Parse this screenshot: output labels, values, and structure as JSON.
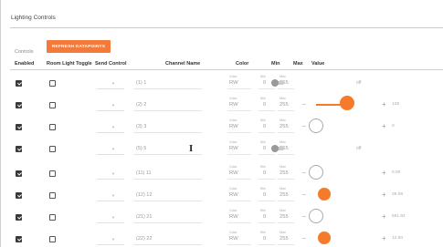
{
  "panel": {
    "title": "Lighting Controls"
  },
  "controls": {
    "label": "Controls",
    "refresh_label": "REFRESH DATAPOINTS"
  },
  "headers": {
    "enabled": "Enabled",
    "room_light_toggle": "Room Light Toggle",
    "send_control": "Send Control",
    "channel_name": "Channel Name",
    "color": "Color",
    "min": "Min",
    "max": "Max",
    "value": "Value"
  },
  "field_captions": {
    "color": "Color",
    "min": "Min",
    "max": "Max"
  },
  "icons": {
    "checkbox": "checkbox-icon",
    "dropdown": "chevron-down-icon",
    "minus": "minus-icon",
    "plus": "plus-icon",
    "cursor": "text-cursor-icon"
  },
  "colors": {
    "accent": "#f27a3a"
  },
  "rows": [
    {
      "enabled": true,
      "room_light": false,
      "channel": "(1) 1",
      "color": "RW",
      "min": "0",
      "max": "255",
      "control": "toggle",
      "value_label": "off"
    },
    {
      "enabled": true,
      "room_light": false,
      "channel": "(2) 2",
      "color": "RW",
      "min": "0",
      "max": "255",
      "control": "slider-full",
      "value_label": "128"
    },
    {
      "enabled": true,
      "room_light": false,
      "channel": "(3) 3",
      "color": "RW",
      "min": "0",
      "max": "255",
      "control": "knob-empty",
      "value_label": "0"
    },
    {
      "enabled": true,
      "room_light": false,
      "channel": "(5) 5",
      "color": "RW",
      "min": "0",
      "max": "255",
      "control": "toggle",
      "value_label": "off"
    },
    {
      "enabled": true,
      "room_light": false,
      "channel": "(11) 11",
      "color": "RW",
      "min": "0",
      "max": "255",
      "control": "knob-empty",
      "value_label": "0.00"
    },
    {
      "enabled": true,
      "room_light": false,
      "channel": "(12) 12",
      "color": "RW",
      "min": "0",
      "max": "255",
      "control": "knob-filled",
      "value_label": "25.08"
    },
    {
      "enabled": true,
      "room_light": false,
      "channel": "(21) 21",
      "color": "RW",
      "min": "0",
      "max": "255",
      "control": "knob-empty",
      "value_label": "651.84"
    },
    {
      "enabled": true,
      "room_light": false,
      "channel": "(22) 22",
      "color": "RW",
      "min": "0",
      "max": "255",
      "control": "knob-filled",
      "value_label": "12.00"
    }
  ]
}
